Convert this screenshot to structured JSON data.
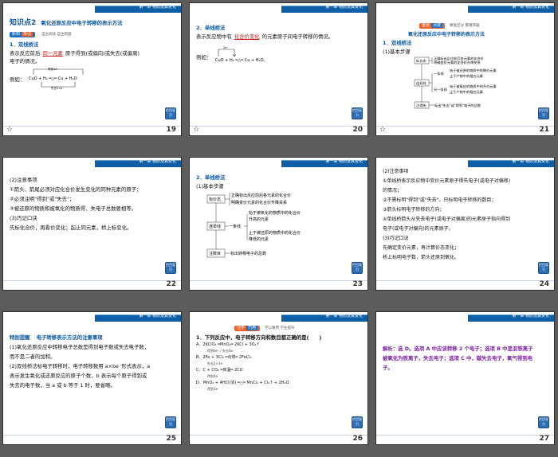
{
  "header_tag": "第一章  物质及其变化",
  "back_label": "栏目导引",
  "slides": [
    {
      "number": "19",
      "title_num": "知识点2",
      "title_text": "氧化还原反应中电子转移的表示方法",
      "badge_a": "新知",
      "badge_b": "导引",
      "badge_note": "自主阅读  自主梳理",
      "sec": "1．双线桥法",
      "line1a": "表示反应前后",
      "line1b": "同一元素",
      "line1c": "原子得到(或偏向)或失去(或偏离)",
      "line2": "电子的情况。",
      "ex_label": "例如：",
      "eq": "CuO + H₂ ═△═ Cu + H₂O",
      "gain": "得到2e⁻",
      "lose": "失去2×e⁻"
    },
    {
      "number": "20",
      "sec": "2．单线桥法",
      "line1a": "表示反应物中有",
      "line1b": "化合价变化",
      "line1c": "的元素原子间电子转移的情况。",
      "ex_label": "例如：",
      "eq": "CuO + H₂ ═△═ Cu + H₂O。",
      "arrow": "2e⁻"
    },
    {
      "number": "21",
      "banner_a": "重要",
      "banner_b": "点拨",
      "banner_note": "精准区分  重难突破",
      "title": "氧化还原反应中电子转移的表示方法",
      "sec": "1．双线桥法",
      "step": "(1)基本步骤",
      "b1": "标价态",
      "b2": "连双线",
      "b3": "注得失",
      "d1": "正确标出反应前后各元素的化合价",
      "d2": "明确变价元素的化合价升降关系",
      "d3": "一条线",
      "d3a": "始于被还原的物质中的降价元素",
      "d3b": "止于产物中的相应元素",
      "d4": "另一条线",
      "d4a": "始于被氧化的物质中的升价元素",
      "d4b": "止于产物中的相应元素",
      "d5": "标出\"失去\"或\"得到\"电子的总数"
    },
    {
      "number": "22",
      "lines": [
        "(2)注意事项",
        "①箭头、箭尾必须对应化合价发生变化的同种元素的原子；",
        "②必须注明\"得到\"或\"失去\"；",
        "③被还原的物质和被氧化的物质得、失电子总数要相等。",
        "(3)巧记口诀",
        "先标化合价，再看价变化；起止同元素，桥上标变化。"
      ]
    },
    {
      "number": "23",
      "sec": "2．单线桥法",
      "step": "(1)基本步骤",
      "b1": "标价态",
      "b2": "连单线",
      "b3": "注数目",
      "d1": "正确标出反应前后各元素的化合价",
      "d2": "明确变价元素的化合价升降关系",
      "d3": "一条线",
      "d3a": "始于被氧化的物质中的化合价",
      "d3a2": "升高的元素",
      "d3b": "止于被还原的物质中的化合价",
      "d3b2": "降低的元素",
      "d4": "标出转移电子的总数"
    },
    {
      "number": "24",
      "lines": [
        "(2)注意事项",
        "①单线桥表示反应物中变价元素原子得失电子(或电子对偏移)",
        "的情况；",
        "②不需标明\"得到\"或\"失去\"，只标明电子转移的数目；",
        "③箭头标明电子转移的方向；",
        "④单线桥箭头从失去电子(或电子对偏离)的元素原子指向得到",
        "电子(或电子对偏向)的元素原子。",
        "(3)巧记口诀",
        "先确定变价元素，再计算价态变化；",
        "桥上标明电子数，箭头还原到氧化。"
      ]
    },
    {
      "number": "25",
      "tip": "特别提醒",
      "tip_title": "电子转移表示方法的注意事项",
      "lines": [
        "(1)氧化还原反应中转移电子总数是得到电子数或失去电子数，",
        "而不是二者的加和。",
        "(2)双线桥法标电子转移时，电子转移数用 a×be⁻形式表示，a",
        "表示发生氧化或还原反应的原子个数，b 表示每个原子得到或",
        "失去的电子数，当 a 或 b 等于 1 时，要省略。"
      ]
    },
    {
      "number": "26",
      "banner_a": "活学",
      "banner_b": "巧用",
      "banner_note": "学以致用  学业提升",
      "question": "1．下列反应中，电子转移方向和数目都正确的是(　　)",
      "opts": [
        {
          "label": "A．",
          "eq": "2KClO₃ ═MnO₂═ 2KCl + 3O₂↑",
          "note": "得到6e⁻ / 失去6e⁻"
        },
        {
          "label": "B．",
          "eq": "2Fe + 3Cl₂ ═点燃═ 2FeCl₃",
          "note": "失去2×3e⁻"
        },
        {
          "label": "C．",
          "eq": "C + CO₂ ═高温═ 2CO",
          "note": "得到4e⁻"
        },
        {
          "label": "D．",
          "eq": "MnO₂ + 4HCl(浓) ═△═ MnCl₂ + Cl₂↑ + 2H₂O",
          "note": "得到2e⁻"
        }
      ]
    },
    {
      "number": "27",
      "answer": "解析：选 D。选项 A 中应该转移 2 个电子；选项 B 中是亚铁离子被氧化为铁离子，失去电子；选项 C 中，碳失去电子，氧气得到电子。"
    }
  ]
}
